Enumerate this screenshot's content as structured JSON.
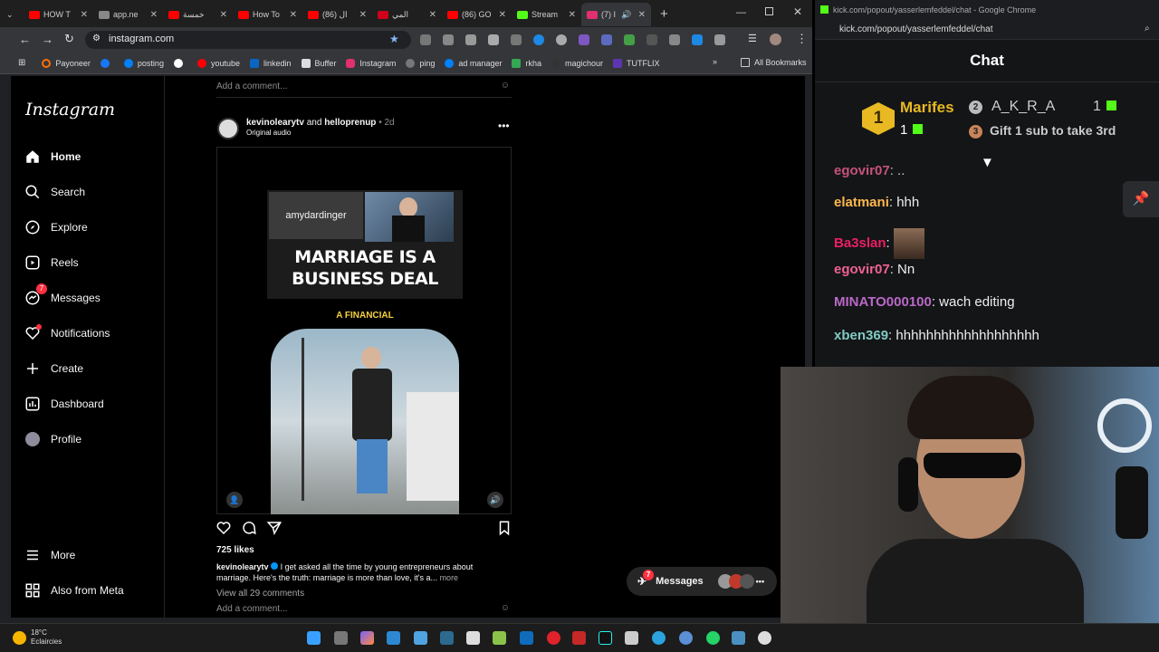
{
  "browser": {
    "tabs": [
      {
        "label": "HOW T",
        "color": "#ff0000"
      },
      {
        "label": "app.ne",
        "color": "#888888"
      },
      {
        "label": "خمسة",
        "color": "#ff0000"
      },
      {
        "label": "How To",
        "color": "#ff0000"
      },
      {
        "label": "(86) ال",
        "color": "#ff0000"
      },
      {
        "label": "المي",
        "color": "#d0021b"
      },
      {
        "label": "(86) GO",
        "color": "#ff0000"
      },
      {
        "label": "Stream",
        "color": "#53fc18"
      },
      {
        "label": "(7) I",
        "color": "#e1306c"
      }
    ],
    "url": "instagram.com",
    "bookmarks": [
      "Payoneer",
      "posting",
      "youtube",
      "linkedin",
      "Buffer",
      "Instagram",
      "ping",
      "ad manager",
      "rkha",
      "magichour",
      "TUTFLIX"
    ],
    "all_bookmarks": "All Bookmarks"
  },
  "instagram": {
    "logo": "Instagram",
    "nav": [
      {
        "label": "Home",
        "icon": "home-icon"
      },
      {
        "label": "Search",
        "icon": "search-icon"
      },
      {
        "label": "Explore",
        "icon": "compass-icon"
      },
      {
        "label": "Reels",
        "icon": "reels-icon"
      },
      {
        "label": "Messages",
        "icon": "messenger-icon"
      },
      {
        "label": "Notifications",
        "icon": "heart-icon"
      },
      {
        "label": "Create",
        "icon": "plus-icon"
      },
      {
        "label": "Dashboard",
        "icon": "dashboard-icon"
      },
      {
        "label": "Profile",
        "icon": "avatar-icon"
      }
    ],
    "messages_badge": "7",
    "more": "More",
    "also_from_meta": "Also from Meta",
    "add_comment": "Add a comment...",
    "post": {
      "author": "kevinolearytv",
      "and": "and",
      "coauthor": "helloprenup",
      "time": "2d",
      "audio": "Original audio",
      "video_name_tag": "amydardinger",
      "video_headline_1": "MARRIAGE IS A",
      "video_headline_2": "BUSINESS DEAL",
      "video_caption": "A FINANCIAL",
      "likes": "725 likes",
      "caption_author": "kevinolearytv",
      "caption": "I get asked all the time by young entrepreneurs about marriage. Here's the truth: marriage is more than love, it's a...",
      "more": "more",
      "view_comments": "View all 29 comments"
    },
    "messages_pill": "Messages"
  },
  "chat": {
    "window_title": "kick.com/popout/yasserlemfeddel/chat - Google Chrome",
    "url": "kick.com/popout/yasserlemfeddel/chat",
    "title": "Chat",
    "gifter1": {
      "rank": "1",
      "name": "Marifes",
      "count": "1"
    },
    "gifter2": {
      "rank": "2",
      "name": "A_K_R_A",
      "count": "1"
    },
    "gifter3": {
      "rank": "3",
      "text": "Gift 1 sub to take 3rd"
    },
    "messages": [
      {
        "user": "egovir07",
        "text": ": ..",
        "color": "#f06292"
      },
      {
        "user": "elatmani",
        "text": ": hhh",
        "color": "#ffb74d"
      },
      {
        "user": "Ba3slan",
        "text": ":",
        "color": "#e91e63"
      },
      {
        "user": "egovir07",
        "text": ": Nn",
        "color": "#f06292"
      },
      {
        "user": "MINATO000100",
        "text": ": wach editing",
        "color": "#ba68c8"
      },
      {
        "user": "xben369",
        "text": ": hhhhhhhhhhhhhhhhhhh",
        "color": "#80cbc4"
      }
    ]
  },
  "taskbar": {
    "temp": "18°C",
    "weather": "Eclaircies"
  }
}
